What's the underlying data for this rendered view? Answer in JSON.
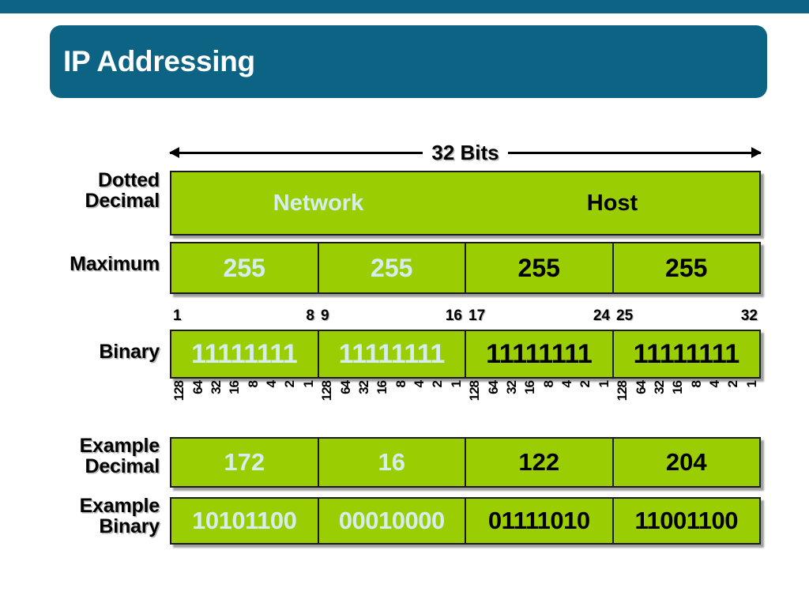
{
  "slide": {
    "title": "IP Addressing",
    "accent_color": "#0c6384",
    "band_color": "#9acd02",
    "light_text_color": "#d6edf0",
    "dark_text_color": "#000000"
  },
  "diagram": {
    "width_label": "32 Bits",
    "rows": {
      "dotted_decimal": {
        "label": "Dotted\nDecimal",
        "cells": [
          {
            "text": "Network",
            "tone": "light"
          },
          {
            "text": "Host",
            "tone": "dark"
          }
        ]
      },
      "maximum": {
        "label": "Maximum",
        "cells": [
          {
            "text": "255",
            "tone": "light"
          },
          {
            "text": "255",
            "tone": "light"
          },
          {
            "text": "255",
            "tone": "dark"
          },
          {
            "text": "255",
            "tone": "dark"
          }
        ]
      },
      "binary": {
        "label": "Binary",
        "cells": [
          {
            "text": "11111111",
            "tone": "light"
          },
          {
            "text": "11111111",
            "tone": "light"
          },
          {
            "text": "11111111",
            "tone": "dark"
          },
          {
            "text": "11111111",
            "tone": "dark"
          }
        ]
      },
      "example_decimal": {
        "label": "Example\nDecimal",
        "cells": [
          {
            "text": "172",
            "tone": "light"
          },
          {
            "text": "16",
            "tone": "light"
          },
          {
            "text": "122",
            "tone": "dark"
          },
          {
            "text": "204",
            "tone": "dark"
          }
        ]
      },
      "example_binary": {
        "label": "Example\nBinary",
        "cells": [
          {
            "text": "10101100",
            "tone": "light"
          },
          {
            "text": "00010000",
            "tone": "light"
          },
          {
            "text": "01111010",
            "tone": "dark"
          },
          {
            "text": "11001100",
            "tone": "dark"
          }
        ]
      }
    },
    "bit_ranges": [
      {
        "start": "1",
        "end": "8"
      },
      {
        "start": "9",
        "end": "16"
      },
      {
        "start": "17",
        "end": "24"
      },
      {
        "start": "25",
        "end": "32"
      }
    ],
    "place_values": [
      "128",
      "64",
      "32",
      "16",
      "8",
      "4",
      "2",
      "1"
    ]
  }
}
